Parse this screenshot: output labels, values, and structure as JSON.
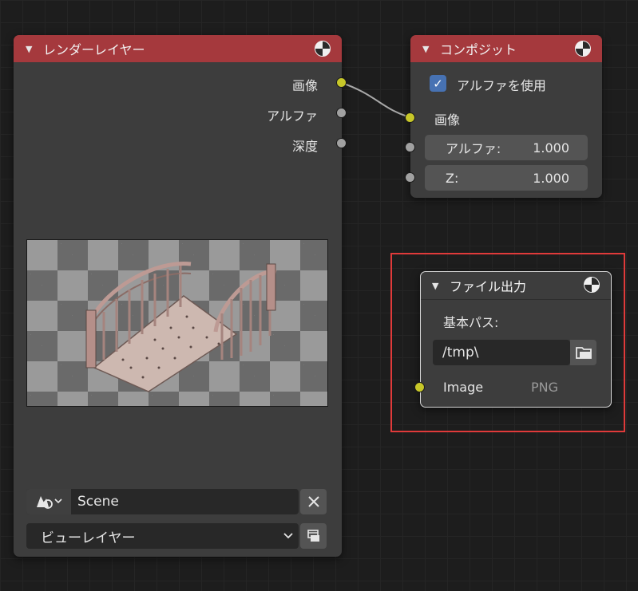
{
  "render_layers_node": {
    "title": "レンダーレイヤー",
    "outputs": [
      "画像",
      "アルファ",
      "深度"
    ],
    "scene_value": "Scene",
    "view_layer_value": "ビューレイヤー",
    "icons": [
      "chevron-down-icon",
      "pin-icon",
      "scene-icon",
      "close-icon",
      "render-icon"
    ]
  },
  "composite_node": {
    "title": "コンポジット",
    "use_alpha_label": "アルファを使用",
    "use_alpha_checked": true,
    "image_label": "画像",
    "alpha_label": "アルファ:",
    "alpha_value": "1.000",
    "z_label": "Z:",
    "z_value": "1.000"
  },
  "file_output_node": {
    "title": "ファイル出力",
    "base_path_label": "基本パス:",
    "base_path_value": "/tmp\\",
    "input_label": "Image",
    "format": "PNG"
  },
  "colors": {
    "header_red": "#a5393d",
    "socket_yellow": "#c7c729",
    "socket_gray": "#a1a1a1",
    "highlight": "#e03a3a",
    "checkbox_blue": "#4772b3"
  }
}
